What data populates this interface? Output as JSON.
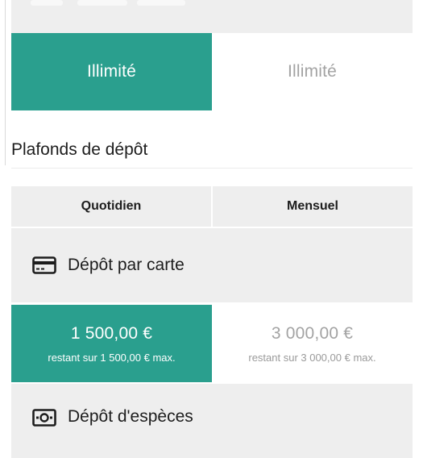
{
  "withdrawal_limits_row": {
    "daily_value": "Illimité",
    "monthly_value": "Illimité"
  },
  "deposit_limits": {
    "title": "Plafonds de dépôt",
    "columns": [
      "Quotidien",
      "Mensuel"
    ],
    "methods": [
      {
        "label": "Dépôt par carte",
        "icon": "credit-card-icon",
        "daily": {
          "value": "1 500,00 €",
          "remaining": "restant sur 1 500,00 € max."
        },
        "monthly": {
          "value": "3 000,00 €",
          "remaining": "restant sur 3 000,00 € max."
        }
      },
      {
        "label": "Dépôt d'espèces",
        "icon": "banknote-icon"
      }
    ]
  },
  "colors": {
    "accent_teal": "#2a9f8e",
    "row_gray": "#eeeeee",
    "muted_text": "#a3a3a3"
  }
}
